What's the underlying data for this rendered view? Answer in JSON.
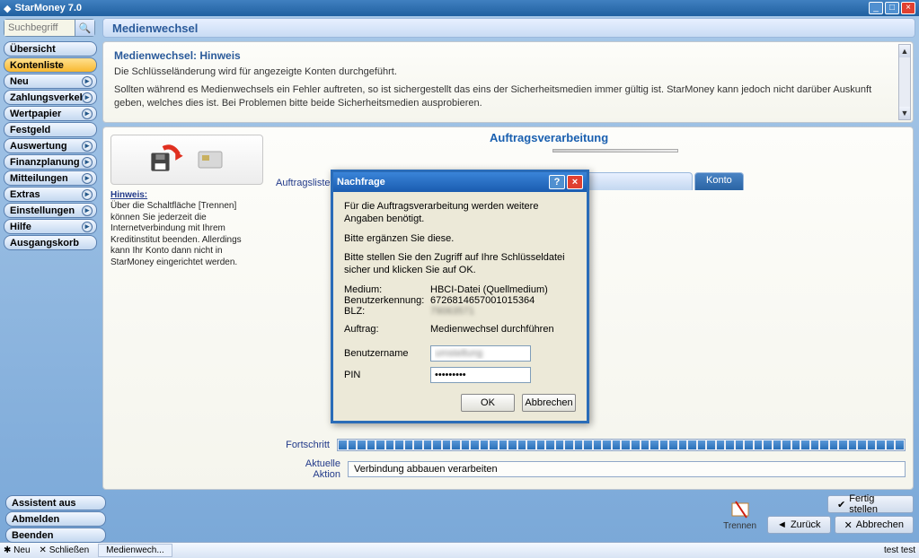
{
  "window": {
    "title": "StarMoney 7.0"
  },
  "search": {
    "placeholder": "Suchbegriff"
  },
  "page_title": "Medienwechsel",
  "sidebar": {
    "items": [
      {
        "label": "Übersicht",
        "hasSub": false
      },
      {
        "label": "Kontenliste",
        "hasSub": false,
        "active": true
      },
      {
        "label": "Neu",
        "hasSub": true
      },
      {
        "label": "Zahlungsverkehr",
        "hasSub": true
      },
      {
        "label": "Wertpapier",
        "hasSub": true
      },
      {
        "label": "Festgeld",
        "hasSub": false
      },
      {
        "label": "Auswertung",
        "hasSub": true
      },
      {
        "label": "Finanzplanung",
        "hasSub": true
      },
      {
        "label": "Mitteilungen",
        "hasSub": true
      },
      {
        "label": "Extras",
        "hasSub": true
      },
      {
        "label": "Einstellungen",
        "hasSub": true
      },
      {
        "label": "Hilfe",
        "hasSub": true
      },
      {
        "label": "Ausgangskorb",
        "hasSub": false
      }
    ]
  },
  "info": {
    "heading": "Medienwechsel: Hinweis",
    "line1": "Die Schlüsseländerung wird für angezeigte Konten durchgeführt.",
    "line2": "Sollten während es Medienwechsels ein Fehler auftreten, so ist sichergestellt das eins der Sicherheitsmedien immer gültig ist. StarMoney kann jedoch nicht darüber Auskunft geben, welches dies ist. Bei Problemen bitte beide Sicherheitsmedien ausprobieren."
  },
  "hinweis": {
    "title": "Hinweis:",
    "body": "Über die Schaltfläche [Trennen] können Sie jederzeit die Internetverbindung mit Ihrem Kreditinstitut beenden. Allerdings kann Ihr Konto dann nicht in StarMoney eingerichtet werden."
  },
  "labels": {
    "auftragsliste": "Auftragsliste",
    "auftragsverarbeitung": "Auftragsverarbeitung",
    "konto_tab": "Konto",
    "fortschritt": "Fortschritt",
    "aktuelle_aktion": "Aktuelle Aktion",
    "aktion_value": "Verbindung abbauen verarbeiten"
  },
  "bottom": {
    "assistent_aus": "Assistent aus",
    "abmelden": "Abmelden",
    "beenden": "Beenden",
    "trennen": "Trennen",
    "fertig": "Fertig stellen",
    "zurueck": "Zurück",
    "abbrechen": "Abbrechen"
  },
  "taskbar": {
    "neu": "Neu",
    "schliessen": "Schließen",
    "tab": "Medienwech...",
    "right": "test test"
  },
  "dialog": {
    "title": "Nachfrage",
    "p1": "Für die Auftragsverarbeitung werden weitere Angaben benötigt.",
    "p2": "Bitte ergänzen Sie diese.",
    "p3": "Bitte stellen Sie den Zugriff auf Ihre Schlüsseldatei sicher und klicken Sie auf OK.",
    "medium_k": "Medium:",
    "medium_v": "HBCI-Datei (Quellmedium)",
    "benutzerk_k": "Benutzerkennung:",
    "benutzerk_v": "6726814657001015364",
    "blz_k": "BLZ:",
    "blz_v": "79063571",
    "auftrag_k": "Auftrag:",
    "auftrag_v": "Medienwechsel durchführen",
    "benutzername_k": "Benutzername",
    "benutzername_v": "umstellung",
    "pin_k": "PIN",
    "pin_v": "•••••••••",
    "ok": "OK",
    "cancel": "Abbrechen"
  }
}
